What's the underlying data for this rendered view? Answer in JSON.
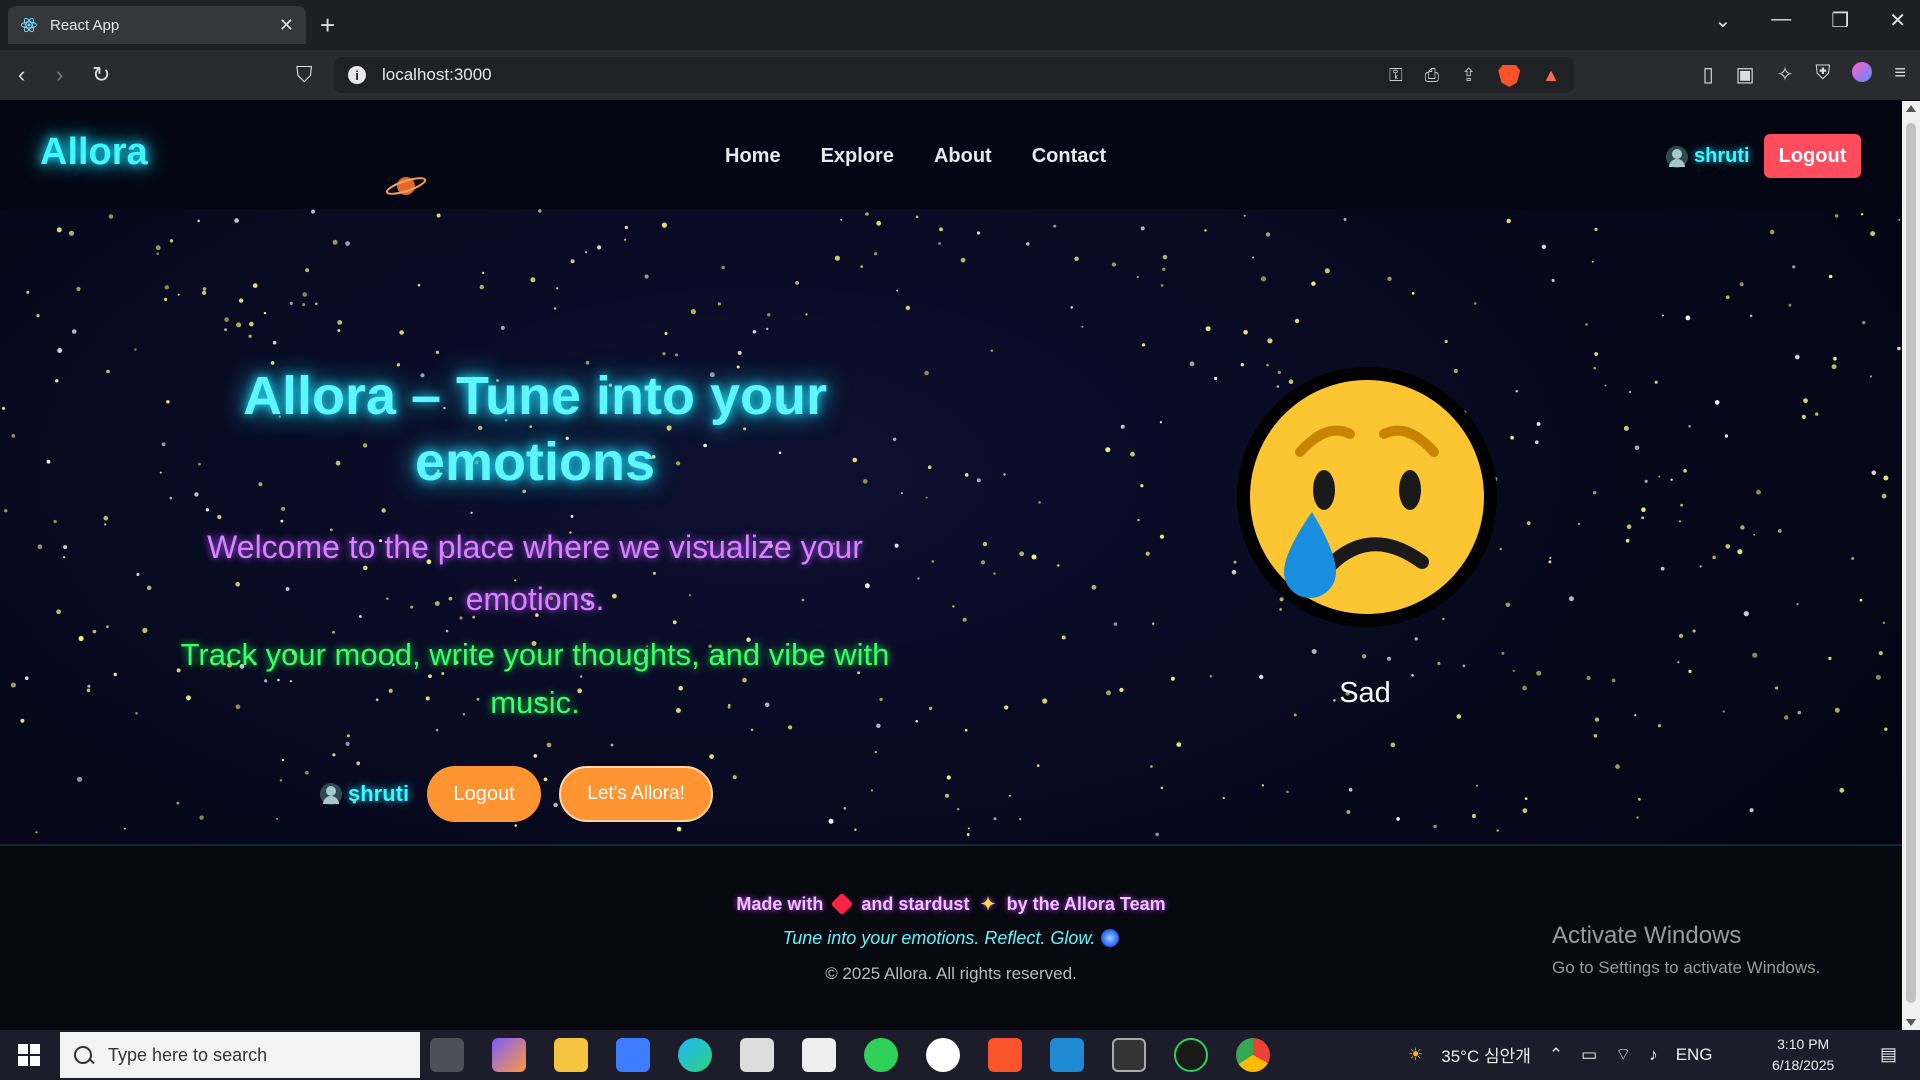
{
  "browser": {
    "tab_title": "React App",
    "url": "localhost:3000",
    "notification_count": "1"
  },
  "navbar": {
    "brand": "Allora",
    "links": [
      "Home",
      "Explore",
      "About",
      "Contact"
    ],
    "username": "shruti",
    "logout_label": "Logout"
  },
  "hero": {
    "title": "Allora – Tune into your emotions",
    "subtitle": "Welcome to the place where we visualize your emotions.",
    "tagline": "Track your mood, write your thoughts, and vibe with music.",
    "username": "shruti",
    "logout_label": "Logout",
    "cta_label": "Let's Allora!"
  },
  "mood": {
    "emoji": "sad-face",
    "label": "Sad"
  },
  "footer": {
    "made_with_prefix": "Made with",
    "made_with_mid": "and stardust",
    "made_with_suffix": "by the Allora Team",
    "motto": "Tune into your emotions. Reflect. Glow.",
    "copyright": "© 2025 Allora. All rights reserved."
  },
  "watermark": {
    "title": "Activate Windows",
    "subtitle": "Go to Settings to activate Windows."
  },
  "taskbar": {
    "search_placeholder": "Type here to search",
    "weather": "35°C 심안개",
    "language": "ENG",
    "time": "3:10 PM",
    "date": "6/18/2025"
  },
  "colors": {
    "neon_cyan": "#3ff7ff",
    "neon_purple": "#d683ff",
    "neon_green": "#39ff6a",
    "logout_red": "#ff4d5e",
    "button_orange": "#ff9433"
  }
}
